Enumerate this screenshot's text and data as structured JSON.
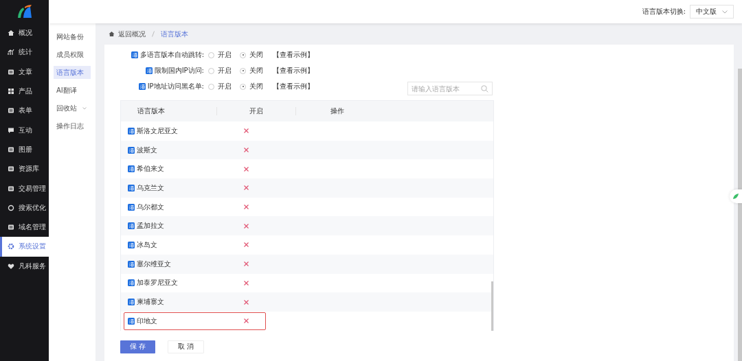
{
  "sidebar": {
    "items": [
      {
        "label": "概况",
        "kind": "home",
        "selected": false
      },
      {
        "label": "统计",
        "kind": "chart",
        "selected": false
      },
      {
        "label": "文章",
        "kind": "doc",
        "selected": false
      },
      {
        "label": "产品",
        "kind": "grid",
        "selected": false
      },
      {
        "label": "表单",
        "kind": "doc",
        "selected": false
      },
      {
        "label": "互动",
        "kind": "chat",
        "selected": false
      },
      {
        "label": "图册",
        "kind": "doc",
        "selected": false
      },
      {
        "label": "资源库",
        "kind": "doc",
        "selected": false
      },
      {
        "label": "交易管理",
        "kind": "doc",
        "selected": false
      },
      {
        "label": "搜索优化",
        "kind": "target",
        "selected": false
      },
      {
        "label": "域名管理",
        "kind": "doc",
        "selected": false
      },
      {
        "label": "系统设置",
        "kind": "gear",
        "selected": true
      },
      {
        "label": "凡科服务",
        "kind": "heart",
        "selected": false
      }
    ]
  },
  "header": {
    "switch_label": "语言版本切换:",
    "switch_value": "中文版"
  },
  "subnav": [
    {
      "label": "网站备份",
      "selected": false,
      "has_dropdown": false
    },
    {
      "label": "成员权限",
      "selected": false,
      "has_dropdown": false
    },
    {
      "label": "语言版本",
      "selected": true,
      "has_dropdown": false
    },
    {
      "label": "AI翻译",
      "selected": false,
      "has_dropdown": false
    },
    {
      "label": "回收站",
      "selected": false,
      "has_dropdown": true
    },
    {
      "label": "操作日志",
      "selected": false,
      "has_dropdown": false
    }
  ],
  "breadcrumb": [
    {
      "label": "返回概况",
      "selected": false
    },
    {
      "label": "语言版本",
      "selected": true
    }
  ],
  "settings": [
    {
      "label": "多语言版本自动跳转:",
      "options": [
        {
          "label": "开启",
          "selected": false
        },
        {
          "label": "关闭",
          "selected": true
        }
      ],
      "link": "【查看示例】"
    },
    {
      "label": "限制国内IP访问:",
      "options": [
        {
          "label": "开启",
          "selected": false
        },
        {
          "label": "关闭",
          "selected": true
        }
      ],
      "link": "【查看示例】"
    },
    {
      "label": "IP地址访问黑名单:",
      "options": [
        {
          "label": "开启",
          "selected": false
        },
        {
          "label": "关闭",
          "selected": true
        }
      ],
      "link": "【查看示例】"
    }
  ],
  "search": {
    "placeholder": "请输入语言版本"
  },
  "table": {
    "columns": [
      "语言版本",
      "开启",
      "操作"
    ],
    "rows": [
      {
        "name": "斯洛文尼亚文",
        "enabled": false,
        "highlighted": false
      },
      {
        "name": "波斯文",
        "enabled": false,
        "highlighted": false
      },
      {
        "name": "希伯来文",
        "enabled": false,
        "highlighted": false
      },
      {
        "name": "乌克兰文",
        "enabled": false,
        "highlighted": false
      },
      {
        "name": "乌尔都文",
        "enabled": false,
        "highlighted": false
      },
      {
        "name": "孟加拉文",
        "enabled": false,
        "highlighted": false
      },
      {
        "name": "冰岛文",
        "enabled": false,
        "highlighted": false
      },
      {
        "name": "塞尔维亚文",
        "enabled": false,
        "highlighted": false
      },
      {
        "name": "加泰罗尼亚文",
        "enabled": false,
        "highlighted": false
      },
      {
        "name": "柬埔寨文",
        "enabled": false,
        "highlighted": false
      },
      {
        "name": "印地文",
        "enabled": false,
        "highlighted": true
      }
    ]
  },
  "buttons": [
    {
      "label": "保 存",
      "kind": "primary"
    },
    {
      "label": "取 消",
      "kind": "default"
    }
  ]
}
